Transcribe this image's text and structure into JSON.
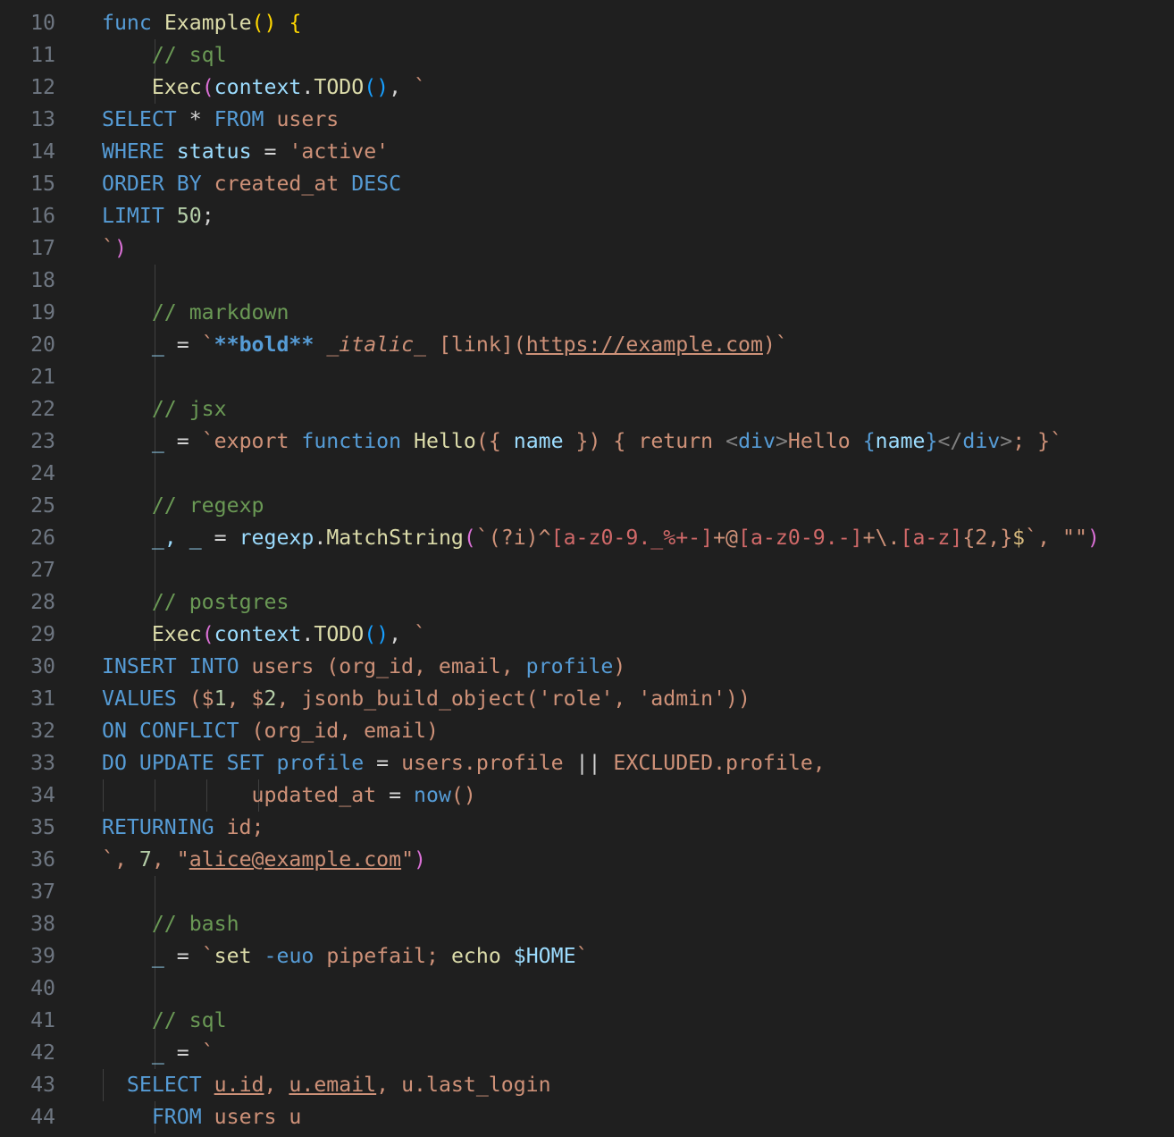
{
  "editor": {
    "theme": {
      "background": "#1f1f1f",
      "line_number": "#6e7681",
      "indent_guide": "#404040"
    },
    "lines": [
      {
        "n": "10",
        "guides": [],
        "tokens": [
          [
            "func ",
            "kw"
          ],
          [
            "Example",
            "fn"
          ],
          [
            "()",
            "br1"
          ],
          [
            " ",
            "punc"
          ],
          [
            "{",
            "br1"
          ]
        ]
      },
      {
        "n": "11",
        "guides": [
          1
        ],
        "tokens": [
          [
            "    ",
            "punc"
          ],
          [
            "// sql",
            "com"
          ]
        ]
      },
      {
        "n": "12",
        "guides": [
          1
        ],
        "tokens": [
          [
            "    ",
            "punc"
          ],
          [
            "Exec",
            "fn"
          ],
          [
            "(",
            "br2"
          ],
          [
            "context",
            "var"
          ],
          [
            ".",
            "punc"
          ],
          [
            "TODO",
            "fn"
          ],
          [
            "()",
            "br3"
          ],
          [
            ", ",
            "punc"
          ],
          [
            "`",
            "str"
          ]
        ]
      },
      {
        "n": "13",
        "guides": [],
        "tokens": [
          [
            "SELECT",
            "kw"
          ],
          [
            " * ",
            "punc"
          ],
          [
            "FROM",
            "kw"
          ],
          [
            " users",
            "str"
          ]
        ]
      },
      {
        "n": "14",
        "guides": [],
        "tokens": [
          [
            "WHERE",
            "kw"
          ],
          [
            " status",
            "var"
          ],
          [
            " = ",
            "punc"
          ],
          [
            "'active'",
            "str"
          ]
        ]
      },
      {
        "n": "15",
        "guides": [],
        "tokens": [
          [
            "ORDER BY",
            "kw"
          ],
          [
            " created_at ",
            "str"
          ],
          [
            "DESC",
            "kw"
          ]
        ]
      },
      {
        "n": "16",
        "guides": [],
        "tokens": [
          [
            "LIMIT",
            "kw"
          ],
          [
            " ",
            "punc"
          ],
          [
            "50",
            "num"
          ],
          [
            ";",
            "punc"
          ]
        ]
      },
      {
        "n": "17",
        "guides": [],
        "tokens": [
          [
            "`",
            "str"
          ],
          [
            ")",
            "br2"
          ]
        ]
      },
      {
        "n": "18",
        "guides": [
          1
        ],
        "tokens": []
      },
      {
        "n": "19",
        "guides": [
          1
        ],
        "tokens": [
          [
            "    ",
            "punc"
          ],
          [
            "// markdown",
            "com"
          ]
        ]
      },
      {
        "n": "20",
        "guides": [
          1
        ],
        "tokens": [
          [
            "    ",
            "punc"
          ],
          [
            "_",
            "var"
          ],
          [
            " = ",
            "punc"
          ],
          [
            "`",
            "str"
          ],
          [
            "**bold**",
            "bold"
          ],
          [
            " ",
            "str"
          ],
          [
            "_italic_",
            "ital"
          ],
          [
            " [link](",
            "str"
          ],
          [
            "https://example.com",
            "link"
          ],
          [
            ")`",
            "str"
          ]
        ]
      },
      {
        "n": "21",
        "guides": [
          1
        ],
        "tokens": []
      },
      {
        "n": "22",
        "guides": [
          1
        ],
        "tokens": [
          [
            "    ",
            "punc"
          ],
          [
            "// jsx",
            "com"
          ]
        ]
      },
      {
        "n": "23",
        "guides": [
          1
        ],
        "tokens": [
          [
            "    ",
            "punc"
          ],
          [
            "_",
            "var"
          ],
          [
            " = ",
            "punc"
          ],
          [
            "`export ",
            "str"
          ],
          [
            "function",
            "kw"
          ],
          [
            " ",
            "punc"
          ],
          [
            "Hello",
            "fn"
          ],
          [
            "({ ",
            "str"
          ],
          [
            "name",
            "var"
          ],
          [
            " }) { ",
            "str"
          ],
          [
            "return",
            "str"
          ],
          [
            " ",
            "punc"
          ],
          [
            "<",
            "tag"
          ],
          [
            "div",
            "kw"
          ],
          [
            ">",
            "tag"
          ],
          [
            "Hello ",
            "str"
          ],
          [
            "{",
            "kw"
          ],
          [
            "name",
            "var"
          ],
          [
            "}",
            "kw"
          ],
          [
            "</",
            "tag"
          ],
          [
            "div",
            "kw"
          ],
          [
            ">",
            "tag"
          ],
          [
            "; }`",
            "str"
          ]
        ]
      },
      {
        "n": "24",
        "guides": [
          1
        ],
        "tokens": []
      },
      {
        "n": "25",
        "guides": [
          1
        ],
        "tokens": [
          [
            "    ",
            "punc"
          ],
          [
            "// regexp",
            "com"
          ]
        ]
      },
      {
        "n": "26",
        "guides": [
          1
        ],
        "tokens": [
          [
            "    ",
            "punc"
          ],
          [
            "_, _",
            "var"
          ],
          [
            " = ",
            "punc"
          ],
          [
            "regexp",
            "var"
          ],
          [
            ".",
            "punc"
          ],
          [
            "MatchString",
            "fn"
          ],
          [
            "(",
            "br2"
          ],
          [
            "`(?i)^",
            "str"
          ],
          [
            "[a-z0-9._%+-]",
            "re"
          ],
          [
            "+@",
            "str"
          ],
          [
            "[a-z0-9.-]",
            "re"
          ],
          [
            "+\\.",
            "str"
          ],
          [
            "[a-z]",
            "re"
          ],
          [
            "{2,}",
            "str"
          ],
          [
            "$",
            "esc"
          ],
          [
            "`, ",
            "str"
          ],
          [
            "\"\"",
            "str"
          ],
          [
            ")",
            "br2"
          ]
        ]
      },
      {
        "n": "27",
        "guides": [
          1
        ],
        "tokens": []
      },
      {
        "n": "28",
        "guides": [
          1
        ],
        "tokens": [
          [
            "    ",
            "punc"
          ],
          [
            "// postgres",
            "com"
          ]
        ]
      },
      {
        "n": "29",
        "guides": [
          1
        ],
        "tokens": [
          [
            "    ",
            "punc"
          ],
          [
            "Exec",
            "fn"
          ],
          [
            "(",
            "br2"
          ],
          [
            "context",
            "var"
          ],
          [
            ".",
            "punc"
          ],
          [
            "TODO",
            "fn"
          ],
          [
            "()",
            "br3"
          ],
          [
            ", ",
            "punc"
          ],
          [
            "`",
            "str"
          ]
        ]
      },
      {
        "n": "30",
        "guides": [],
        "tokens": [
          [
            "INSERT INTO",
            "kw"
          ],
          [
            " users (org_id, email, ",
            "str"
          ],
          [
            "profile",
            "kw"
          ],
          [
            ")",
            "str"
          ]
        ]
      },
      {
        "n": "31",
        "guides": [],
        "tokens": [
          [
            "VALUES",
            "kw"
          ],
          [
            " ($",
            "str"
          ],
          [
            "1",
            "num"
          ],
          [
            ", $",
            "str"
          ],
          [
            "2",
            "num"
          ],
          [
            ", jsonb_build_object('role', 'admin'))",
            "str"
          ]
        ]
      },
      {
        "n": "32",
        "guides": [],
        "tokens": [
          [
            "ON CONFLICT",
            "kw"
          ],
          [
            " (org_id, email)",
            "str"
          ]
        ]
      },
      {
        "n": "33",
        "guides": [],
        "tokens": [
          [
            "DO UPDATE SET",
            "kw"
          ],
          [
            " ",
            "punc"
          ],
          [
            "profile",
            "kw"
          ],
          [
            " = ",
            "punc"
          ],
          [
            "users.profile ",
            "str"
          ],
          [
            "||",
            "punc"
          ],
          [
            " EXCLUDED.profile,",
            "str"
          ]
        ]
      },
      {
        "n": "34",
        "guides": [
          0,
          1,
          2,
          3
        ],
        "tokens": [
          [
            "        ",
            "punc"
          ],
          [
            "    updated_at",
            "str"
          ],
          [
            " = ",
            "punc"
          ],
          [
            "now",
            "kw"
          ],
          [
            "()",
            "str"
          ]
        ]
      },
      {
        "n": "35",
        "guides": [],
        "tokens": [
          [
            "RETURNING",
            "kw"
          ],
          [
            " id;",
            "str"
          ]
        ]
      },
      {
        "n": "36",
        "guides": [],
        "tokens": [
          [
            "`, ",
            "str"
          ],
          [
            "7",
            "num"
          ],
          [
            ", \"",
            "str"
          ],
          [
            "alice@example.com",
            "link"
          ],
          [
            "\"",
            "str"
          ],
          [
            ")",
            "br2"
          ]
        ]
      },
      {
        "n": "37",
        "guides": [
          1
        ],
        "tokens": []
      },
      {
        "n": "38",
        "guides": [
          1
        ],
        "tokens": [
          [
            "    ",
            "punc"
          ],
          [
            "// bash",
            "com"
          ]
        ]
      },
      {
        "n": "39",
        "guides": [
          1
        ],
        "tokens": [
          [
            "    ",
            "punc"
          ],
          [
            "_",
            "var"
          ],
          [
            " = ",
            "punc"
          ],
          [
            "`",
            "str"
          ],
          [
            "set",
            "fn"
          ],
          [
            " ",
            "punc"
          ],
          [
            "-euo",
            "kw"
          ],
          [
            " pipefail; ",
            "str"
          ],
          [
            "echo",
            "fn"
          ],
          [
            " ",
            "punc"
          ],
          [
            "$HOME",
            "var"
          ],
          [
            "`",
            "str"
          ]
        ]
      },
      {
        "n": "40",
        "guides": [
          1
        ],
        "tokens": []
      },
      {
        "n": "41",
        "guides": [
          1
        ],
        "tokens": [
          [
            "    ",
            "punc"
          ],
          [
            "// sql",
            "com"
          ]
        ]
      },
      {
        "n": "42",
        "guides": [
          1
        ],
        "tokens": [
          [
            "    ",
            "punc"
          ],
          [
            "_",
            "var"
          ],
          [
            " = ",
            "punc"
          ],
          [
            "`",
            "str"
          ]
        ]
      },
      {
        "n": "43",
        "guides": [
          0
        ],
        "tokens": [
          [
            "  ",
            "punc"
          ],
          [
            "SELECT",
            "kw"
          ],
          [
            " ",
            "punc"
          ],
          [
            "u.id",
            "link"
          ],
          [
            ", ",
            "str"
          ],
          [
            "u.email",
            "link"
          ],
          [
            ", u.last_login",
            "str"
          ]
        ]
      },
      {
        "n": "44",
        "guides": [
          1
        ],
        "tokens": [
          [
            "    ",
            "punc"
          ],
          [
            "FROM",
            "kw"
          ],
          [
            " users u",
            "str"
          ]
        ]
      }
    ]
  }
}
